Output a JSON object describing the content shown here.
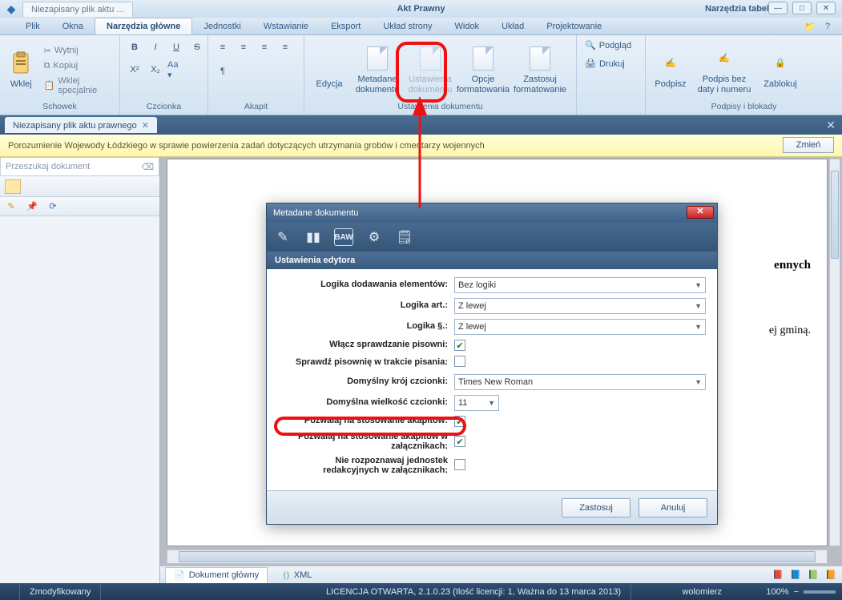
{
  "title_tab": "Niezapisany plik aktu ...",
  "context_title_center": "Akt Prawny",
  "context_title_right": "Narzędzia tabel",
  "menu": {
    "plik": "Plik",
    "okna": "Okna",
    "narz_gl": "Narzędzia główne",
    "jednostki": "Jednostki",
    "wstawianie": "Wstawianie",
    "eksport": "Eksport",
    "uklad_strony": "Układ strony",
    "widok": "Widok",
    "uklad": "Układ",
    "projektowanie": "Projektowanie"
  },
  "ribbon": {
    "schowek": {
      "label": "Schowek",
      "wklej": "Wklej",
      "wytnij": "Wytnij",
      "kopiuj": "Kopiuj",
      "wklej_spec": "Wklej specjalnie"
    },
    "czcionka": {
      "label": "Czcionka"
    },
    "akapit": {
      "label": "Akapit"
    },
    "ustaw_dok": {
      "label": "Ustawienia dokumentu",
      "edycja": "Edycja",
      "metadane": "Metadane dokumentu",
      "ustawienia": "Ustawienia dokumentu",
      "opcje": "Opcje formatowania",
      "zastosuj": "Zastosuj formatowanie"
    },
    "podpisy": {
      "label": "Podpisy i blokady",
      "podglad": "Podgląd",
      "drukuj": "Drukuj",
      "podpisz": "Podpisz",
      "podpis_bez": "Podpis bez daty i numeru",
      "zablokuj": "Zablokuj"
    }
  },
  "doc_tab": "Niezapisany plik aktu prawnego",
  "infobar_text": "Porozumienie Wojewody Łódzkiego w sprawie powierzenia zadań dotyczących utrzymania grobów i cmentarzy wojennych",
  "infobar_btn": "Zmień",
  "search_placeholder": "Przeszukaj dokument",
  "page_fragments": {
    "ennych": "ennych",
    "ej_gmina": "ej gminą."
  },
  "bottom_tabs": {
    "glowny": "Dokument główny",
    "xml": "XML"
  },
  "status": {
    "mod": "Zmodyfikowany",
    "lic": "LICENCJA OTWARTA, 2.1.0.23 (Ilość licencji: 1, Ważna do 13 marca 2013)",
    "user": "wolomierz",
    "zoom": "100%"
  },
  "dialog": {
    "title": "Metadane dokumentu",
    "section": "Ustawienia edytora",
    "rows": {
      "logika_dod": {
        "label": "Logika dodawania elementów:",
        "value": "Bez logiki"
      },
      "logika_art": {
        "label": "Logika art.:",
        "value": "Z lewej"
      },
      "logika_par": {
        "label": "Logika §.:",
        "value": "Z lewej"
      },
      "spr_pisow": {
        "label": "Włącz sprawdzanie pisowni:"
      },
      "spr_trakcie": {
        "label": "Sprawdź pisownię w trakcie pisania:"
      },
      "kroj": {
        "label": "Domyślny krój czcionki:",
        "value": "Times New Roman"
      },
      "wielkosc": {
        "label": "Domyślna wielkość czcionki:",
        "value": "11"
      },
      "akapity": {
        "label": "Pozwalaj na stosowanie akapitów:"
      },
      "akapity_zal": {
        "label": "Pozwalaj na stosowanie akapitów w załącznikach:"
      },
      "nie_rozp": {
        "label": "Nie rozpoznawaj jednostek redakcyjnych w załącznikach:"
      }
    },
    "btn_apply": "Zastosuj",
    "btn_cancel": "Anuluj"
  }
}
